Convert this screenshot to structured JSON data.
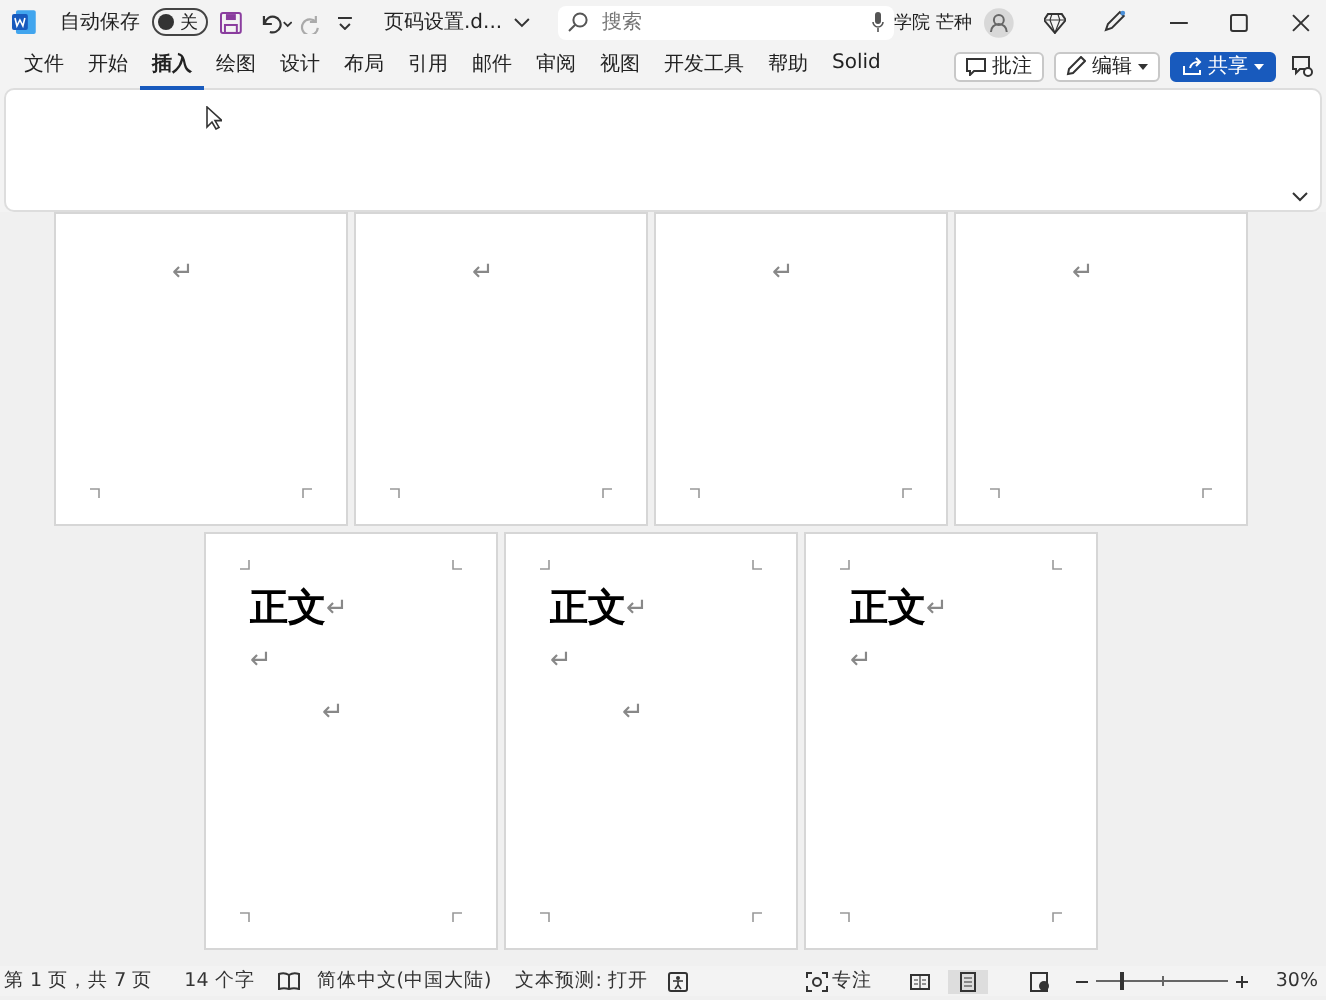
{
  "title_bar": {
    "autosave_label": "自动保存",
    "autosave": {
      "on": false,
      "label": "关"
    },
    "document_title": "页码设置.d...",
    "search": {
      "placeholder": "搜索"
    },
    "user": "学院 芒种"
  },
  "ribbon": {
    "tabs": [
      {
        "label": "文件",
        "selected": false
      },
      {
        "label": "开始",
        "selected": false
      },
      {
        "label": "插入",
        "selected": true
      },
      {
        "label": "绘图",
        "selected": false
      },
      {
        "label": "设计",
        "selected": false
      },
      {
        "label": "布局",
        "selected": false
      },
      {
        "label": "引用",
        "selected": false
      },
      {
        "label": "邮件",
        "selected": false
      },
      {
        "label": "审阅",
        "selected": false
      },
      {
        "label": "视图",
        "selected": false
      },
      {
        "label": "开发工具",
        "selected": false
      },
      {
        "label": "帮助",
        "selected": false
      },
      {
        "label": "Solid",
        "selected": false
      }
    ],
    "buttons": [
      {
        "kind": "comment",
        "label": "批注"
      },
      {
        "kind": "edit",
        "label": "编辑"
      },
      {
        "kind": "share",
        "label": "共享"
      }
    ]
  },
  "top_row_pages": [
    {
      "paragraphs": [
        {
          "kind": "indented",
          "mark": "↵"
        }
      ]
    },
    {
      "paragraphs": [
        {
          "kind": "indented",
          "mark": "↵"
        }
      ]
    },
    {
      "paragraphs": [
        {
          "kind": "indented",
          "mark": "↵"
        }
      ]
    },
    {
      "paragraphs": [
        {
          "kind": "indented",
          "mark": "↵"
        }
      ]
    }
  ],
  "bottom_row_pages": [
    {
      "paragraphs": [
        {
          "kind": "heading",
          "text": "正文",
          "mark": "↵"
        },
        {
          "kind": "empty",
          "mark": "↵"
        },
        {
          "kind": "indented",
          "mark": "↵"
        }
      ]
    },
    {
      "paragraphs": [
        {
          "kind": "heading",
          "text": "正文",
          "mark": "↵"
        },
        {
          "kind": "empty",
          "mark": "↵"
        },
        {
          "kind": "indented",
          "mark": "↵"
        }
      ]
    },
    {
      "paragraphs": [
        {
          "kind": "heading",
          "text": "正文",
          "mark": "↵"
        },
        {
          "kind": "empty",
          "mark": "↵"
        }
      ]
    }
  ],
  "status_bar": {
    "page": "第 1 页，共 7 页",
    "words": "14 个字",
    "language": "简体中文(中国大陆)",
    "text_prediction": "文本预测: 打开",
    "focus": "专注",
    "zoom": {
      "level": 0.2,
      "reading": "30%"
    }
  }
}
